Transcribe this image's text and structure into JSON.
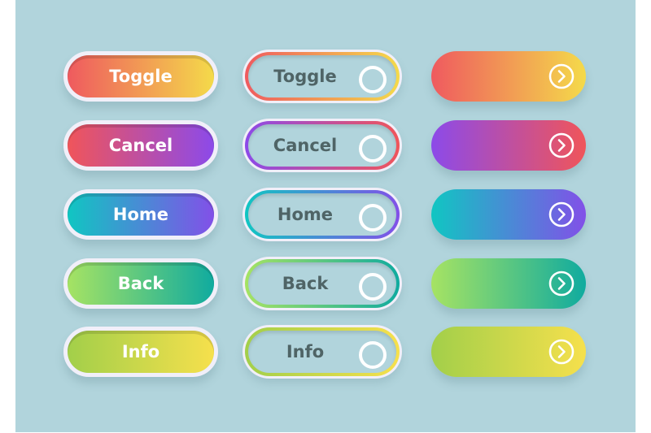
{
  "rows": [
    {
      "label": "Toggle",
      "from": "#ef5a5f",
      "to": "#f4da4a"
    },
    {
      "label": "Cancel",
      "from": "#f0555a",
      "to": "#8c4ae9"
    },
    {
      "label": "Home",
      "from": "#10c6c2",
      "to": "#8250e8"
    },
    {
      "label": "Back",
      "from": "#a6e363",
      "to": "#10ab9f"
    },
    {
      "label": "Info",
      "from": "#a2cf4a",
      "to": "#f6e04c"
    }
  ],
  "col3_reversed": [
    false,
    true,
    false,
    false,
    false
  ],
  "icons": {
    "arrow": "chevron-right-circle-icon",
    "toggle": "toggle-circle-icon"
  }
}
